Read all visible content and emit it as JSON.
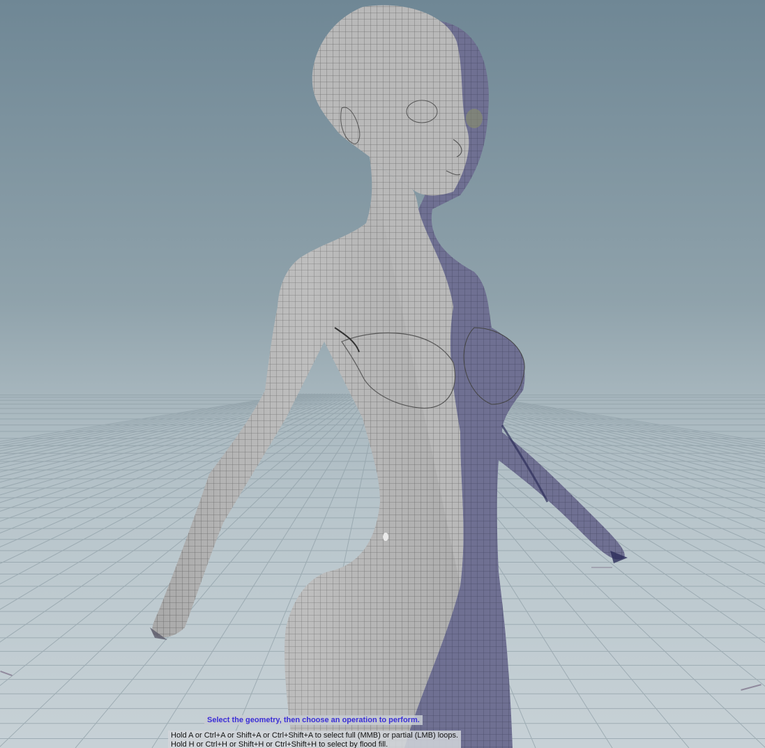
{
  "viewport": {
    "background_top": "#6f8795",
    "background_bottom": "#c7d1d6",
    "mesh_light_color": "#b8b8b8",
    "mesh_shadow_color": "#6f7090"
  },
  "prompt": {
    "main": "Select the geometry, then choose an operation to perform.",
    "help_line1": "Hold A or Ctrl+A or Shift+A or Ctrl+Shift+A to select full (MMB) or partial (LMB) loops.",
    "help_line2": "Hold H or Ctrl+H or Shift+H or Ctrl+Shift+H to select by flood fill."
  }
}
